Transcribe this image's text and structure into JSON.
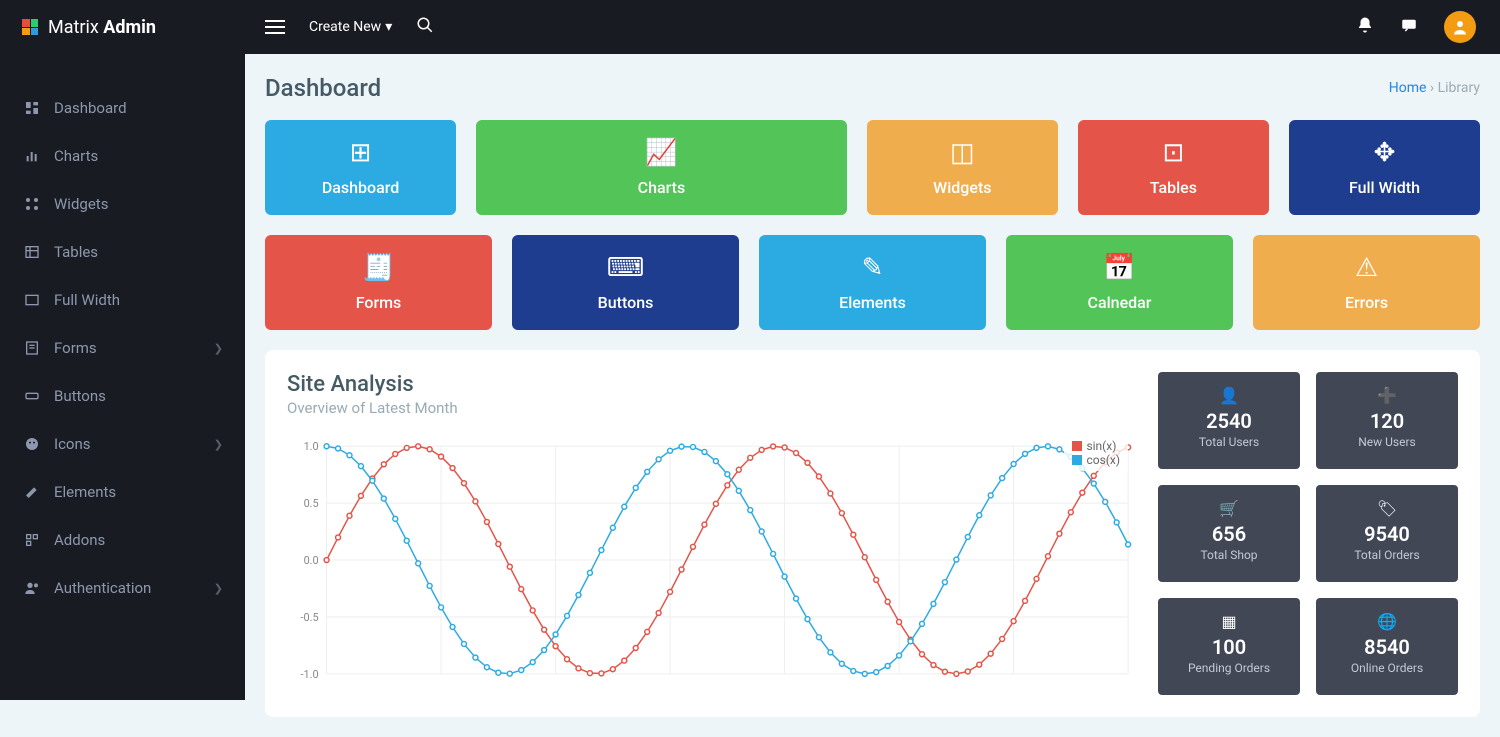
{
  "brand": {
    "name_light": "Matrix ",
    "name_bold": "Admin"
  },
  "topbar": {
    "create_label": "Create New"
  },
  "sidebar": {
    "items": [
      {
        "label": "Dashboard",
        "icon": "dashboard",
        "expand": false
      },
      {
        "label": "Charts",
        "icon": "chart",
        "expand": false
      },
      {
        "label": "Widgets",
        "icon": "widgets",
        "expand": false
      },
      {
        "label": "Tables",
        "icon": "table",
        "expand": false
      },
      {
        "label": "Full Width",
        "icon": "fullwidth",
        "expand": false
      },
      {
        "label": "Forms",
        "icon": "forms",
        "expand": true
      },
      {
        "label": "Buttons",
        "icon": "buttons",
        "expand": false
      },
      {
        "label": "Icons",
        "icon": "icons",
        "expand": true
      },
      {
        "label": "Elements",
        "icon": "elements",
        "expand": false
      },
      {
        "label": "Addons",
        "icon": "addons",
        "expand": false
      },
      {
        "label": "Authentication",
        "icon": "auth",
        "expand": true
      }
    ]
  },
  "page": {
    "title": "Dashboard"
  },
  "breadcrumb": {
    "home": "Home",
    "current": "Library",
    "sep": "›"
  },
  "tiles_row1": [
    {
      "label": "Dashboard",
      "color": "bg-blue",
      "icon": "⊞"
    },
    {
      "label": "Charts",
      "color": "bg-green",
      "icon": "📈"
    },
    {
      "label": "Widgets",
      "color": "bg-orange",
      "icon": "◫"
    },
    {
      "label": "Tables",
      "color": "bg-red",
      "icon": "⊡"
    },
    {
      "label": "Full Width",
      "color": "bg-darkblue",
      "icon": "✥"
    }
  ],
  "tiles_row2": [
    {
      "label": "Forms",
      "color": "bg-red",
      "icon": "🧾"
    },
    {
      "label": "Buttons",
      "color": "bg-darkblue",
      "icon": "⌨"
    },
    {
      "label": "Elements",
      "color": "bg-blue",
      "icon": "✎"
    },
    {
      "label": "Calnedar",
      "color": "bg-green",
      "icon": "📅"
    },
    {
      "label": "Errors",
      "color": "bg-orange",
      "icon": "⚠"
    }
  ],
  "analysis": {
    "title": "Site Analysis",
    "subtitle": "Overview of Latest Month"
  },
  "chart_data": {
    "type": "line",
    "xlim": [
      0,
      14
    ],
    "ylim": [
      -1.0,
      1.0
    ],
    "yticks": [
      -1.0,
      -0.5,
      0.0,
      0.5,
      1.0
    ],
    "series": [
      {
        "name": "sin(x)",
        "color": "#e55448",
        "fn": "sin"
      },
      {
        "name": "cos(x)",
        "color": "#2cabe3",
        "fn": "cos"
      }
    ],
    "step": 0.2
  },
  "stats": [
    {
      "num": "2540",
      "label": "Total Users",
      "icon": "👤"
    },
    {
      "num": "120",
      "label": "New Users",
      "icon": "➕"
    },
    {
      "num": "656",
      "label": "Total Shop",
      "icon": "🛒"
    },
    {
      "num": "9540",
      "label": "Total Orders",
      "icon": "🏷"
    },
    {
      "num": "100",
      "label": "Pending Orders",
      "icon": "▦"
    },
    {
      "num": "8540",
      "label": "Online Orders",
      "icon": "🌐"
    }
  ]
}
